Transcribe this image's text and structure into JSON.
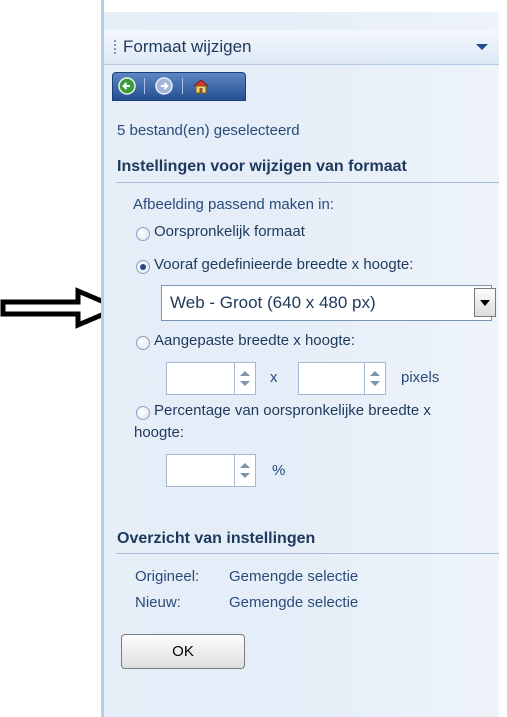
{
  "pane": {
    "title": "Formaat wijzigen"
  },
  "nav": {
    "back_icon": "back-arrow-icon",
    "forward_icon": "forward-arrow-icon",
    "home_icon": "home-icon"
  },
  "selection_info": "5 bestand(en) geselecteerd",
  "settings": {
    "heading": "Instellingen voor wijzigen van formaat",
    "fit_label": "Afbeelding passend maken in:",
    "options": {
      "original": "Oorspronkelijk formaat",
      "predefined": "Vooraf gedefinieerde breedte x hoogte:",
      "custom": "Aangepaste breedte x hoogte:",
      "percentage_line1": "Percentage van oorspronkelijke breedte x",
      "percentage_line2": "hoogte:"
    },
    "selected_option": "predefined",
    "preset_value": "Web - Groot (640 x 480 px)",
    "custom_separator": "x",
    "custom_unit": "pixels",
    "percent_unit": "%"
  },
  "overview": {
    "heading": "Overzicht van instellingen",
    "original_label": "Origineel:",
    "original_value": "Gemengde selectie",
    "new_label": "Nieuw:",
    "new_value": "Gemengde selectie"
  },
  "ok_label": "OK"
}
